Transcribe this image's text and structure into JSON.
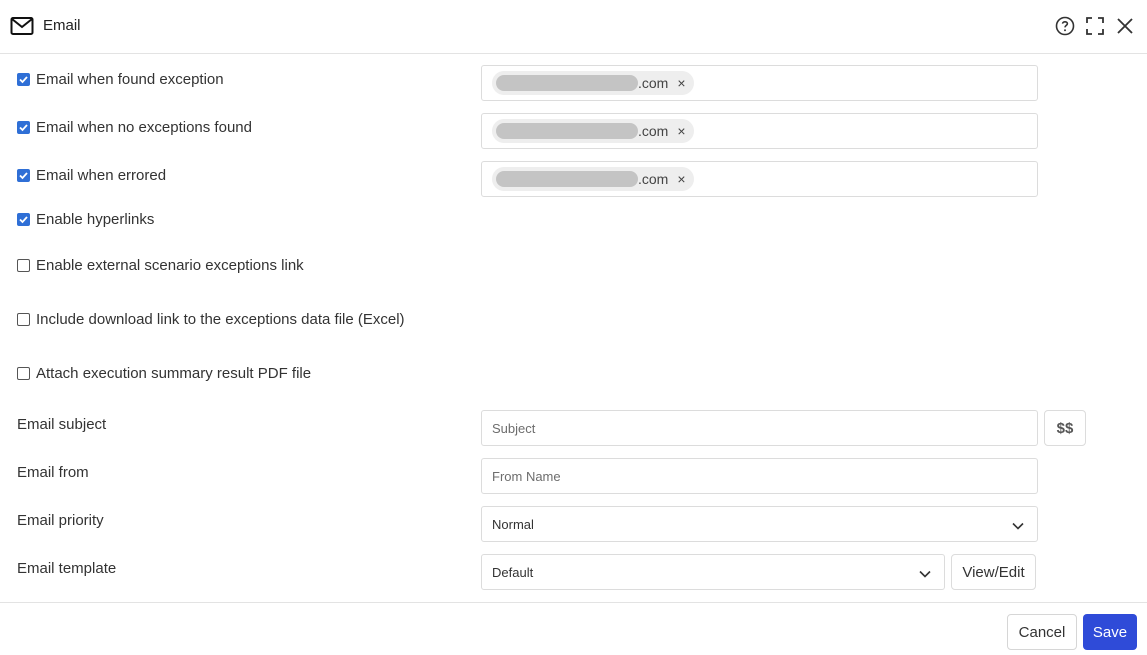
{
  "header": {
    "title": "Email",
    "icons": {
      "title": "mail-icon",
      "help": "help-icon",
      "expand": "expand-icon",
      "close": "close-icon"
    }
  },
  "notifications": [
    {
      "label": "Email when found exception",
      "checked": true,
      "recipient_domain": ".com"
    },
    {
      "label": "Email when no exceptions found",
      "checked": true,
      "recipient_domain": ".com"
    },
    {
      "label": "Email when errored",
      "checked": true,
      "recipient_domain": ".com"
    }
  ],
  "options": [
    {
      "label": "Enable hyperlinks",
      "checked": true
    },
    {
      "label": "Enable external scenario exceptions link",
      "checked": false
    },
    {
      "label": "Include download link to the exceptions data file (Excel)",
      "checked": false
    },
    {
      "label": "Attach execution summary result PDF file",
      "checked": false
    }
  ],
  "fields": {
    "subject": {
      "label": "Email subject",
      "placeholder": "Subject",
      "value": "",
      "variables_button": "$$"
    },
    "from": {
      "label": "Email from",
      "placeholder": "From Name",
      "value": ""
    },
    "priority": {
      "label": "Email priority",
      "value": "Normal"
    },
    "template": {
      "label": "Email template",
      "value": "Default",
      "view_edit_button": "View/Edit"
    }
  },
  "footer": {
    "cancel_label": "Cancel",
    "save_label": "Save"
  },
  "colors": {
    "accent": "#2f4bd8",
    "checkbox": "#2f6fd6",
    "border": "#dcdcdc"
  }
}
